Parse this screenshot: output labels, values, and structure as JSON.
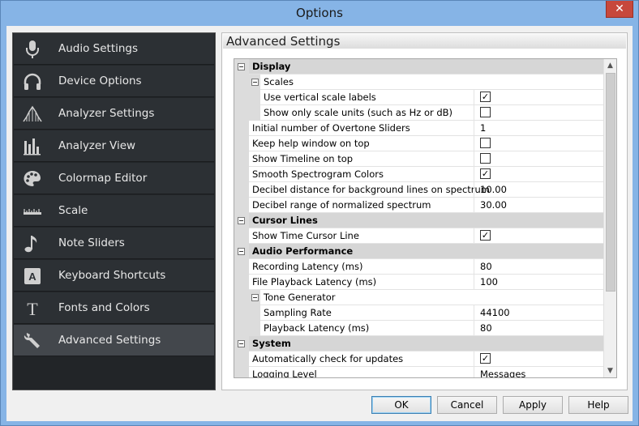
{
  "window": {
    "title": "Options"
  },
  "sidebar": {
    "items": [
      {
        "label": "Audio Settings",
        "icon": "microphone-icon"
      },
      {
        "label": "Device Options",
        "icon": "headphones-icon"
      },
      {
        "label": "Analyzer Settings",
        "icon": "analyzer-settings-icon"
      },
      {
        "label": "Analyzer View",
        "icon": "analyzer-view-icon"
      },
      {
        "label": "Colormap Editor",
        "icon": "palette-icon"
      },
      {
        "label": "Scale",
        "icon": "ruler-icon"
      },
      {
        "label": "Note Sliders",
        "icon": "music-note-icon"
      },
      {
        "label": "Keyboard Shortcuts",
        "icon": "keyboard-key-icon"
      },
      {
        "label": "Fonts and Colors",
        "icon": "font-icon"
      },
      {
        "label": "Advanced Settings",
        "icon": "wrench-icon"
      }
    ],
    "active_index": 9
  },
  "content": {
    "title": "Advanced Settings"
  },
  "grid": {
    "rows": [
      {
        "kind": "category",
        "name": "Display"
      },
      {
        "kind": "subcategory",
        "name": "Scales"
      },
      {
        "kind": "subitem",
        "name": "Use vertical scale labels",
        "type": "check",
        "checked": true
      },
      {
        "kind": "subitem",
        "name": "Show only scale units (such as Hz or dB)",
        "type": "check",
        "checked": false
      },
      {
        "kind": "item",
        "name": "Initial number of Overtone Sliders",
        "type": "text",
        "value": "1"
      },
      {
        "kind": "item",
        "name": "Keep help window on top",
        "type": "check",
        "checked": false
      },
      {
        "kind": "item",
        "name": "Show Timeline on top",
        "type": "check",
        "checked": false
      },
      {
        "kind": "item",
        "name": "Smooth Spectrogram Colors",
        "type": "check",
        "checked": true
      },
      {
        "kind": "item",
        "name": "Decibel distance for background lines on spectrum",
        "type": "text",
        "value": "10.00"
      },
      {
        "kind": "item",
        "name": "Decibel range of normalized spectrum",
        "type": "text",
        "value": "30.00"
      },
      {
        "kind": "category",
        "name": "Cursor Lines"
      },
      {
        "kind": "item",
        "name": "Show Time Cursor Line",
        "type": "check",
        "checked": true
      },
      {
        "kind": "category",
        "name": "Audio Performance"
      },
      {
        "kind": "item",
        "name": "Recording Latency (ms)",
        "type": "text",
        "value": "80"
      },
      {
        "kind": "item",
        "name": "File Playback Latency (ms)",
        "type": "text",
        "value": "100"
      },
      {
        "kind": "subcategory",
        "name": "Tone Generator"
      },
      {
        "kind": "subitem",
        "name": "Sampling Rate",
        "type": "text",
        "value": "44100"
      },
      {
        "kind": "subitem",
        "name": "Playback Latency (ms)",
        "type": "text",
        "value": "80"
      },
      {
        "kind": "category",
        "name": "System"
      },
      {
        "kind": "item",
        "name": "Automatically check for updates",
        "type": "check",
        "checked": true
      },
      {
        "kind": "item",
        "name": "Logging Level",
        "type": "text",
        "value": "Messages"
      }
    ]
  },
  "buttons": {
    "ok": "OK",
    "cancel": "Cancel",
    "apply": "Apply",
    "help": "Help"
  },
  "colors": {
    "sidebar_bg": "#222528",
    "sidebar_active": "#43474c",
    "titlebar": "#86b4e6",
    "close": "#c7483c"
  }
}
